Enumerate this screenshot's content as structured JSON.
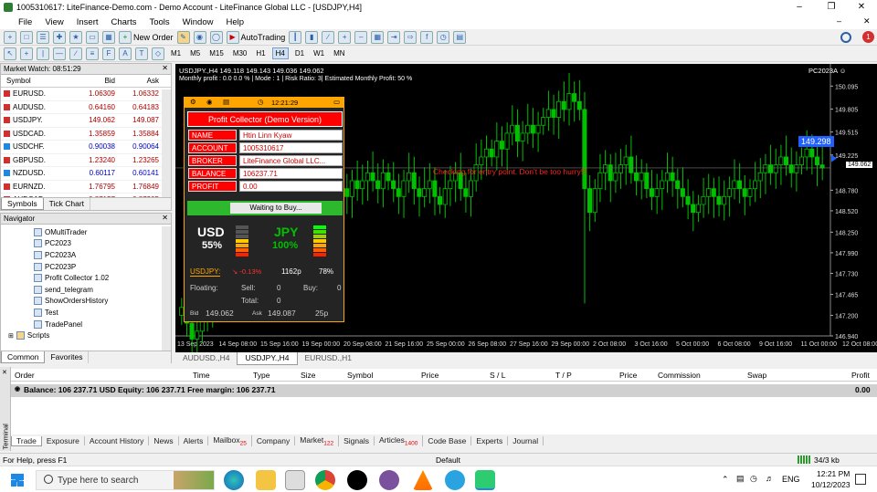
{
  "window": {
    "title": "1005310617: LiteFinance-Demo.com - Demo Account - LiteFinance Global LLC - [USDJPY,H4]"
  },
  "menu": [
    "File",
    "View",
    "Insert",
    "Charts",
    "Tools",
    "Window",
    "Help"
  ],
  "toolbar": {
    "new_order": "New Order",
    "autotrading": "AutoTrading",
    "alert_count": "1"
  },
  "timeframes": [
    "M1",
    "M5",
    "M15",
    "M30",
    "H1",
    "H4",
    "D1",
    "W1",
    "MN"
  ],
  "active_timeframe": "H4",
  "market_watch": {
    "title": "Market Watch: 08:51:29",
    "columns": [
      "Symbol",
      "Bid",
      "Ask"
    ],
    "rows": [
      {
        "symbol": "EURUSD.",
        "bid": "1.06309",
        "ask": "1.06332",
        "dir": "down"
      },
      {
        "symbol": "AUDUSD.",
        "bid": "0.64160",
        "ask": "0.64183",
        "dir": "down"
      },
      {
        "symbol": "USDJPY.",
        "bid": "149.062",
        "ask": "149.087",
        "dir": "down"
      },
      {
        "symbol": "USDCAD.",
        "bid": "1.35859",
        "ask": "1.35884",
        "dir": "down"
      },
      {
        "symbol": "USDCHF.",
        "bid": "0.90038",
        "ask": "0.90064",
        "dir": "up"
      },
      {
        "symbol": "GBPUSD.",
        "bid": "1.23240",
        "ask": "1.23265",
        "dir": "down"
      },
      {
        "symbol": "NZDUSD.",
        "bid": "0.60117",
        "ask": "0.60141",
        "dir": "up"
      },
      {
        "symbol": "EURNZD.",
        "bid": "1.76795",
        "ask": "1.76849",
        "dir": "down"
      },
      {
        "symbol": "AUDCAD.",
        "bid": "0.87157",
        "ask": "0.87205",
        "dir": "down"
      }
    ],
    "tabs": [
      "Symbols",
      "Tick Chart"
    ]
  },
  "navigator": {
    "title": "Navigator",
    "items": [
      "OMultiTrader",
      "PC2023",
      "PC2023A",
      "PC2023P",
      "Profit Collector 1.02",
      "send_telegram",
      "ShowOrdersHistory",
      "Test",
      "TradePanel"
    ],
    "scripts": "Scripts",
    "tabs": [
      "Common",
      "Favorites"
    ]
  },
  "chart": {
    "header_line1": "USDJPY.,H4  149.118 149.143 149.036 149.062",
    "header_line2": "Monthly profit : 0.0  0.0 %  |  Mode : 1  |  Risk Ratio: 3|  Estimated Monthly Profit: 50 %",
    "expert_label": "PC2023A",
    "price_labels": [
      "150.095",
      "149.805",
      "149.515",
      "149.225",
      "148.780",
      "148.520",
      "148.250",
      "147.990",
      "147.730",
      "147.465",
      "147.200",
      "146.940"
    ],
    "current_price": "149.062",
    "price_marker": "149.298",
    "message": "Checking for entry point. Don't be too hurry!!!",
    "time_labels": [
      "13 Sep 2023",
      "14 Sep 08:00",
      "15 Sep 16:00",
      "19 Sep 00:00",
      "20 Sep 08:00",
      "21 Sep 16:00",
      "25 Sep 00:00",
      "26 Sep 08:00",
      "27 Sep 16:00",
      "29 Sep 00:00",
      "2 Oct 08:00",
      "3 Oct 16:00",
      "5 Oct 00:00",
      "6 Oct 08:00",
      "9 Oct 16:00",
      "11 Oct 00:00",
      "12 Oct 08:00"
    ],
    "tabs": [
      "AUDUSD.,H4",
      "USDJPY.,H4",
      "EURUSD.,H1"
    ],
    "active_tab": "USDJPY.,H4",
    "series": {
      "start_price": 147.2,
      "closes": [
        147.3,
        147.1,
        146.9,
        147.0,
        147.2,
        147.4,
        147.3,
        147.5,
        147.6,
        147.4,
        147.5,
        147.7,
        147.6,
        147.8,
        147.9,
        147.7,
        147.5,
        147.6,
        147.8,
        147.7,
        147.9,
        148.0,
        147.9,
        147.8,
        147.9,
        148.1,
        148.3,
        148.2,
        148.4,
        148.5,
        148.6,
        148.8,
        148.7,
        148.9,
        148.8,
        148.9,
        149.0,
        148.9,
        148.8,
        149.0,
        148.9,
        148.8,
        148.7,
        148.9,
        149.0,
        148.8,
        148.7,
        148.8,
        148.9,
        148.7,
        148.6,
        148.8,
        148.9,
        149.0,
        148.8,
        148.7,
        148.9,
        149.1,
        149.2,
        149.3,
        149.2,
        149.4,
        149.3,
        149.5,
        149.6,
        149.4,
        149.5,
        149.6,
        149.5,
        149.6,
        149.7,
        149.8,
        149.7,
        149.9,
        149.8,
        150.0,
        149.9,
        149.8,
        148.8,
        148.5,
        148.8,
        149.0,
        149.1,
        148.9,
        149.0,
        149.1,
        149.2,
        149.0,
        148.9,
        149.0,
        148.8,
        148.7,
        148.8,
        148.9,
        149.0,
        148.9,
        148.8,
        148.7,
        148.6,
        148.5,
        148.6,
        148.7,
        148.8,
        148.7,
        148.6,
        148.7,
        148.8,
        148.9,
        148.8,
        148.7,
        148.8,
        148.9,
        149.0,
        149.1,
        149.0,
        149.1,
        149.2,
        149.1,
        149.0,
        149.1,
        149.2,
        149.3,
        149.2,
        149.1,
        149.06
      ]
    }
  },
  "dashboard": {
    "time": "12:21:29",
    "title": "Profit Collector (Demo Version)",
    "fields": [
      {
        "label": "NAME",
        "value": "Htin Linn Kyaw"
      },
      {
        "label": "ACCOUNT",
        "value": "1005310617"
      },
      {
        "label": "BROKER",
        "value": "LiteFinance Global LLC..."
      },
      {
        "label": "BALANCE",
        "value": "106237.71"
      },
      {
        "label": "PROFIT",
        "value": "0.00"
      }
    ],
    "status": "Waiting to Buy...",
    "cur1": "USD",
    "cur1_pct": "55%",
    "cur2": "JPY",
    "cur2_pct": "100%",
    "symbol": "USDJPY:",
    "change": "-0.13%",
    "pips": "1162p",
    "pct": "78%",
    "floating": "Floating:",
    "sell_lbl": "Sell:",
    "sell": "0",
    "buy_lbl": "Buy:",
    "buy": "0",
    "total_lbl": "Total:",
    "total": "0",
    "bid_lbl": "Bid",
    "bid": "149.062",
    "ask_lbl": "Ask",
    "ask": "149.087",
    "spread": "25p",
    "colors": {
      "header": "#ff0000",
      "status_bar": "#2db82d",
      "green": "#00c000",
      "orange": "#ffa500"
    }
  },
  "terminal": {
    "columns": [
      "Order",
      "Time",
      "Type",
      "Size",
      "Symbol",
      "Price",
      "S / L",
      "T / P",
      "Price",
      "Commission",
      "Swap",
      "Profit"
    ],
    "balance_line": "Balance: 106 237.71 USD  Equity: 106 237.71  Free margin: 106 237.71",
    "balance_profit": "0.00",
    "side_label": "Terminal",
    "tabs": [
      {
        "label": "Trade",
        "badge": ""
      },
      {
        "label": "Exposure",
        "badge": ""
      },
      {
        "label": "Account History",
        "badge": ""
      },
      {
        "label": "News",
        "badge": ""
      },
      {
        "label": "Alerts",
        "badge": ""
      },
      {
        "label": "Mailbox",
        "badge": "25"
      },
      {
        "label": "Company",
        "badge": ""
      },
      {
        "label": "Market",
        "badge": "122"
      },
      {
        "label": "Signals",
        "badge": ""
      },
      {
        "label": "Articles",
        "badge": "1400"
      },
      {
        "label": "Code Base",
        "badge": ""
      },
      {
        "label": "Experts",
        "badge": ""
      },
      {
        "label": "Journal",
        "badge": ""
      }
    ]
  },
  "statusbar": {
    "help": "For Help, press F1",
    "profile": "Default",
    "traffic": "34/3 kb"
  },
  "taskbar": {
    "search": "Type here to search",
    "lang": "ENG",
    "time": "12:21 PM",
    "date": "10/12/2023"
  }
}
